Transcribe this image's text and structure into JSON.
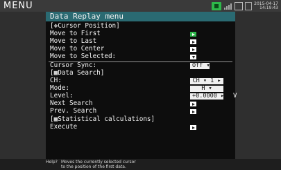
{
  "header": {
    "menu_label": "MENU",
    "date": "2015-04-17",
    "time": "14:19:43",
    "icons": [
      "recording-icon",
      "signal-icon",
      "battery-icon",
      "network-icon"
    ]
  },
  "panel": {
    "title": "Data Replay menu",
    "cursor_section": "[✥Cursor Position]",
    "move_first": "Move to First",
    "move_last": "Move to Last",
    "move_center": "Move to Center",
    "move_selected": "Move to Selected:",
    "cursor_sync_label": "Cursor Sync:",
    "cursor_sync_value": "Off ▾",
    "search_section": "[▦Data Search]",
    "ch_label": "CH:",
    "ch_value": "CH ▾ 1 ▸",
    "mode_label": "Mode:",
    "mode_value": "H ▾",
    "level_label": "Level:",
    "level_value": "+0.0000 ▸",
    "level_unit": "V",
    "next_search": "Next Search",
    "prev_search": "Prev. Search",
    "stat_section": "[▦Statistical calculations]",
    "execute": "Execute"
  },
  "help": {
    "label": "Help?",
    "line1": "Moves the currently selected cursor",
    "line2": "to the position of the first data."
  },
  "colors": {
    "title_bar": "#2a6a72",
    "active_button": "#2fb84c",
    "panel_bg": "#0d0d0d"
  }
}
